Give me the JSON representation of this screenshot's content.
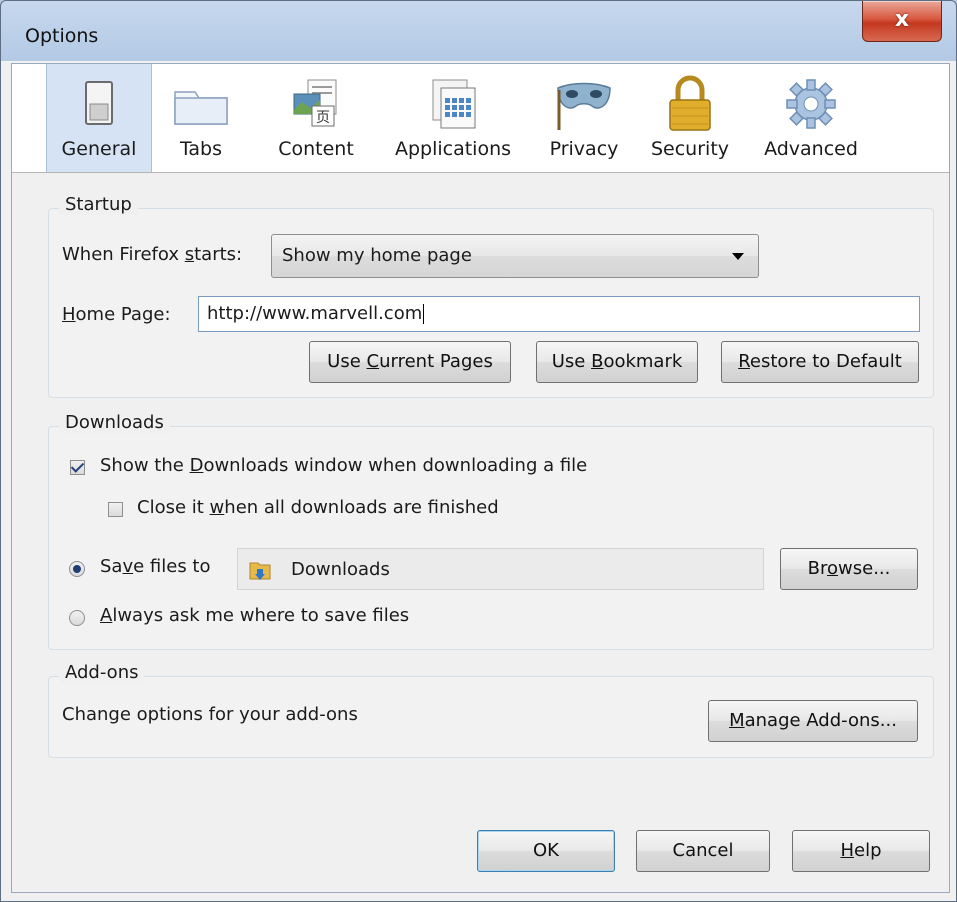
{
  "window": {
    "title": "Options",
    "close_glyph": "x"
  },
  "toolbar": {
    "tabs": [
      {
        "label": "General",
        "icon": "switch-icon",
        "selected": true
      },
      {
        "label": "Tabs",
        "icon": "tabs-icon"
      },
      {
        "label": "Content",
        "icon": "content-icon"
      },
      {
        "label": "Applications",
        "icon": "applications-icon"
      },
      {
        "label": "Privacy",
        "icon": "mask-icon"
      },
      {
        "label": "Security",
        "icon": "lock-icon"
      },
      {
        "label": "Advanced",
        "icon": "gear-icon"
      }
    ]
  },
  "startup": {
    "title": "Startup",
    "when_starts_label": {
      "before": "When Firefox ",
      "key": "s",
      "after": "tarts:"
    },
    "when_starts_value": "Show my home page",
    "home_page_label": {
      "key": "H",
      "after": "ome Page:"
    },
    "home_page_value": "http://www.marvell.com",
    "use_current": {
      "before": "Use ",
      "key": "C",
      "after": "urrent Pages"
    },
    "use_bookmark": {
      "before": "Use ",
      "key": "B",
      "after": "ookmark"
    },
    "restore_default": {
      "key": "R",
      "after": "estore to Default"
    }
  },
  "downloads": {
    "title": "Downloads",
    "show_window": {
      "before": "Show the ",
      "key": "D",
      "after": "ownloads window when downloading a file",
      "checked": true
    },
    "close_it": {
      "before": "Close it ",
      "key": "w",
      "after": "hen all downloads are finished",
      "checked": false
    },
    "save_to": {
      "before": "Sa",
      "key": "v",
      "after": "e files to",
      "selected": true
    },
    "folder_name": "Downloads",
    "browse": {
      "before": "Br",
      "key": "o",
      "after": "wse..."
    },
    "always_ask": {
      "key": "A",
      "after": "lways ask me where to save files",
      "selected": false
    }
  },
  "addons": {
    "title": "Add-ons",
    "description": "Change options for your add-ons",
    "manage": {
      "key": "M",
      "after": "anage Add-ons..."
    }
  },
  "footer": {
    "ok": "OK",
    "cancel": "Cancel",
    "help": {
      "key": "H",
      "after": "elp"
    }
  },
  "colors": {
    "selected_tab": "#d6e3f4",
    "close_button": "#c4381f",
    "accent": "#3c7fb1"
  }
}
